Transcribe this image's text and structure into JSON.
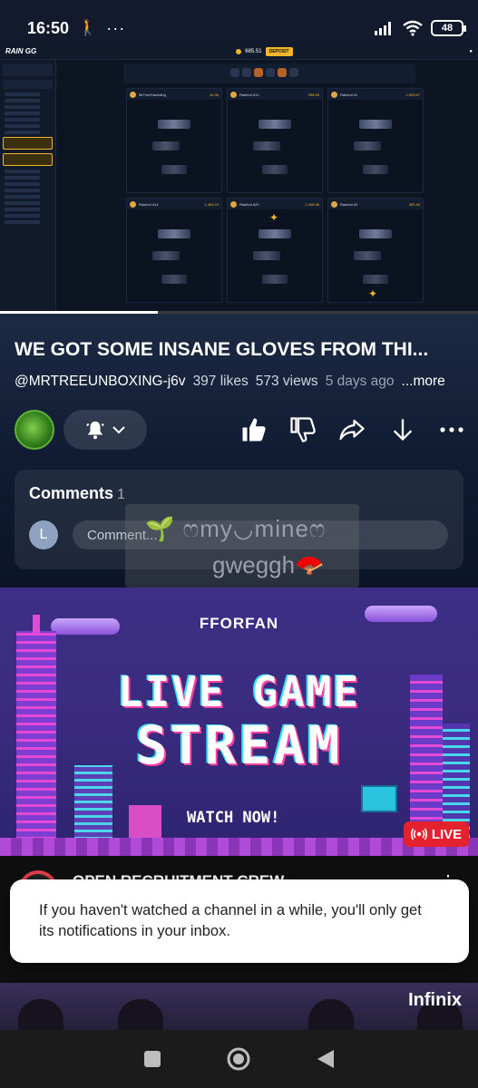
{
  "status_bar": {
    "time": "16:50",
    "battery": "48",
    "extra_icons": [
      "walking-icon",
      "more-dots-icon"
    ]
  },
  "video": {
    "site_logo": "RAIN GG",
    "balance": "685.51",
    "deposit_label": "DEPOSIT",
    "progress_percent": 33,
    "cards": [
      {
        "name": "MrTreeGambling",
        "value": "44.36"
      },
      {
        "name": "Rainbot #12",
        "value": "398.95"
      },
      {
        "name": "Rainbot #1",
        "value": "1,903.57"
      },
      {
        "name": "Rainbot #14",
        "value": "1,369.24"
      },
      {
        "name": "Rainbot #20",
        "value": "2,408.96"
      },
      {
        "name": "Rainbot #2",
        "value": "383.45"
      }
    ]
  },
  "info": {
    "title": "WE GOT SOME INSANE GLOVES FROM THI...",
    "channel": "@MRTREEUNBOXING-j6v",
    "likes": "397 likes",
    "views": "573 views",
    "age": "5 days ago",
    "more": "...more"
  },
  "comments": {
    "heading": "Comments",
    "count": "1",
    "avatar_letter": "L",
    "placeholder": "Comment..."
  },
  "overlay": {
    "line1": "🌱 ෆmy◡mineෆ",
    "line2": "gweggh🪭"
  },
  "live_banner": {
    "brand": "FFORFAN",
    "line1": "LIVE GAME",
    "line2": "STREAM",
    "cta": "WATCH NOW!",
    "live_badge": "LIVE"
  },
  "next_item": {
    "title": "OPEN RECRUITMENT CREW"
  },
  "toast": {
    "text": "If you haven't watched a channel in a while, you'll only get its notifications in your inbox."
  },
  "third_thumb": {
    "brand": "Infinix"
  }
}
